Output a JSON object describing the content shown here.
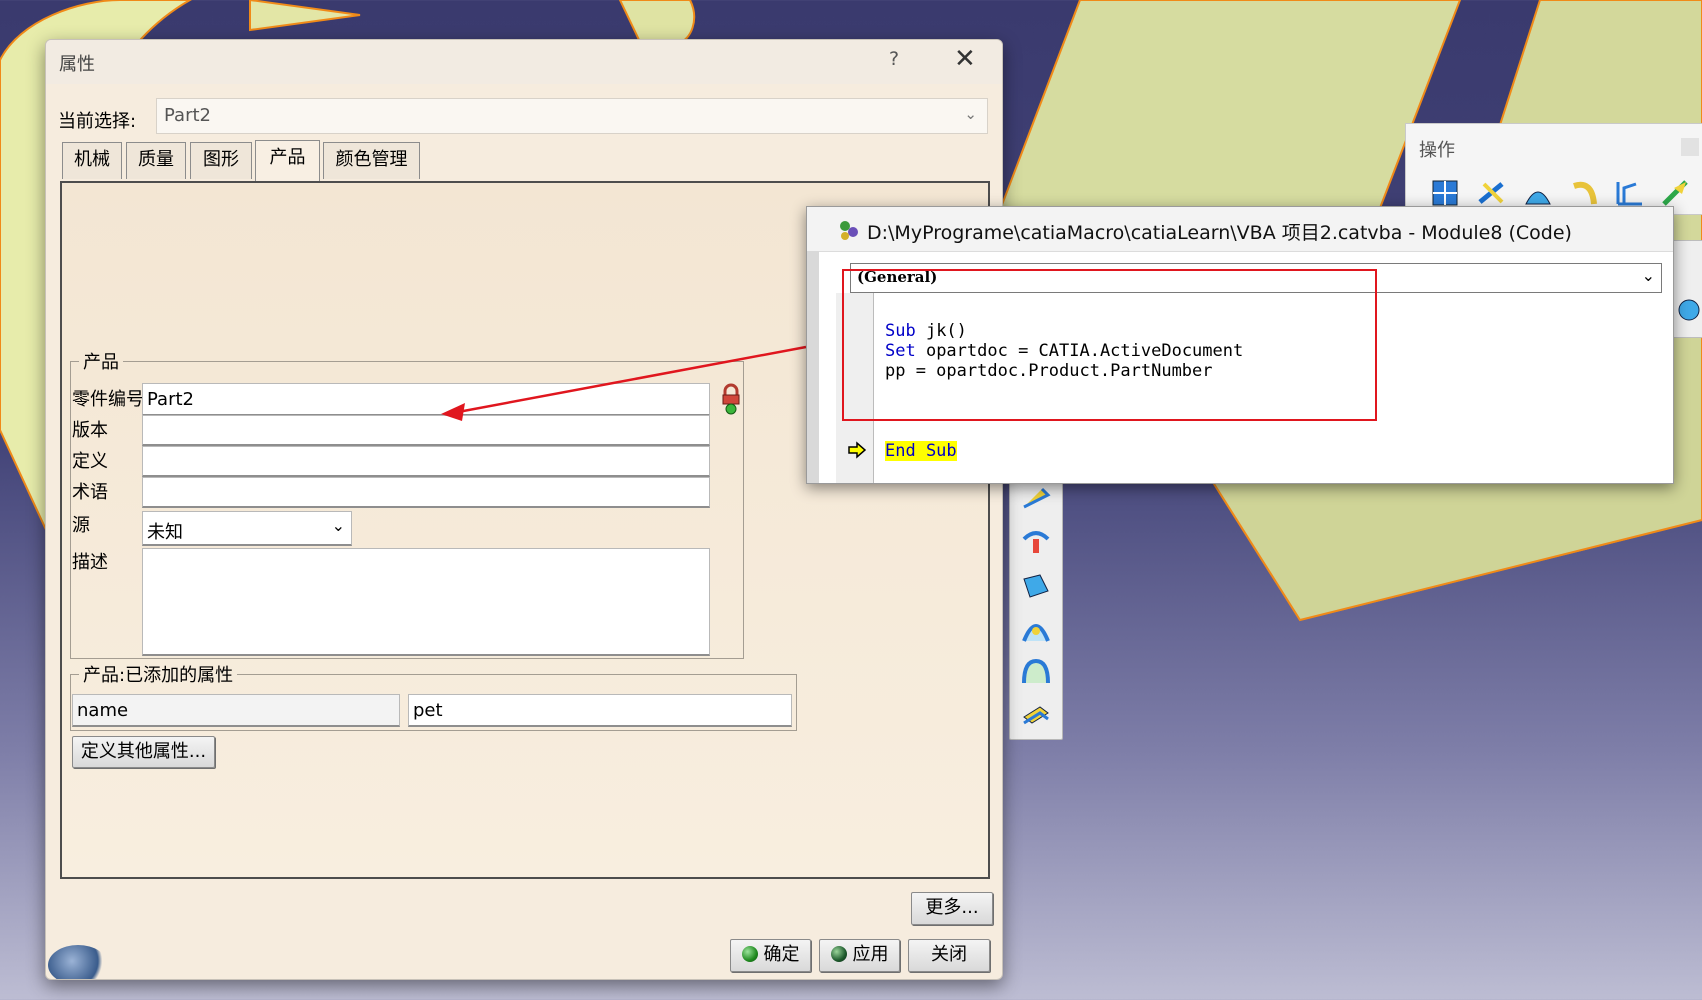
{
  "properties_dialog": {
    "title": "属性",
    "help_glyph": "?",
    "close_glyph": "✕",
    "current_selection_label": "当前选择:",
    "current_selection_value": "Part2",
    "tabs": [
      {
        "label": "机械",
        "active": false
      },
      {
        "label": "质量",
        "active": false
      },
      {
        "label": "图形",
        "active": false
      },
      {
        "label": "产品",
        "active": true
      },
      {
        "label": "颜色管理",
        "active": false
      }
    ],
    "product_group": {
      "legend": "产品",
      "fields": {
        "part_number": {
          "label": "零件编号",
          "value": "Part2"
        },
        "revision": {
          "label": "版本",
          "value": ""
        },
        "definition": {
          "label": "定义",
          "value": ""
        },
        "nomenclature": {
          "label": "术语",
          "value": ""
        },
        "source": {
          "label": "源",
          "value": "未知"
        },
        "description": {
          "label": "描述",
          "value": ""
        }
      }
    },
    "added_props_group": {
      "legend": "产品:已添加的属性",
      "rows": [
        {
          "name": "name",
          "value": "pet"
        }
      ]
    },
    "define_other_button": "定义其他属性...",
    "more_button": "更多...",
    "ok_button": "确定",
    "apply_button": "应用",
    "close_button": "关闭"
  },
  "vba_window": {
    "title": "D:\\MyPrograme\\catiaMacro\\catiaLearn\\VBA 项目2.catvba - Module8 (Code)",
    "object_combo": "(General)",
    "code_lines": [
      {
        "kw": "Sub",
        "rest": " jk()"
      },
      {
        "kw": "Set",
        "rest": " opartdoc = CATIA.ActiveDocument"
      },
      {
        "kw": "",
        "rest": "pp = opartdoc.Product.PartNumber"
      }
    ],
    "end_line": "End Sub",
    "highlight_color": "#ffff00",
    "keyword_color": "#0000c8",
    "annotation_color": "#e0161e"
  },
  "operations_toolbar": {
    "title": "操作"
  }
}
